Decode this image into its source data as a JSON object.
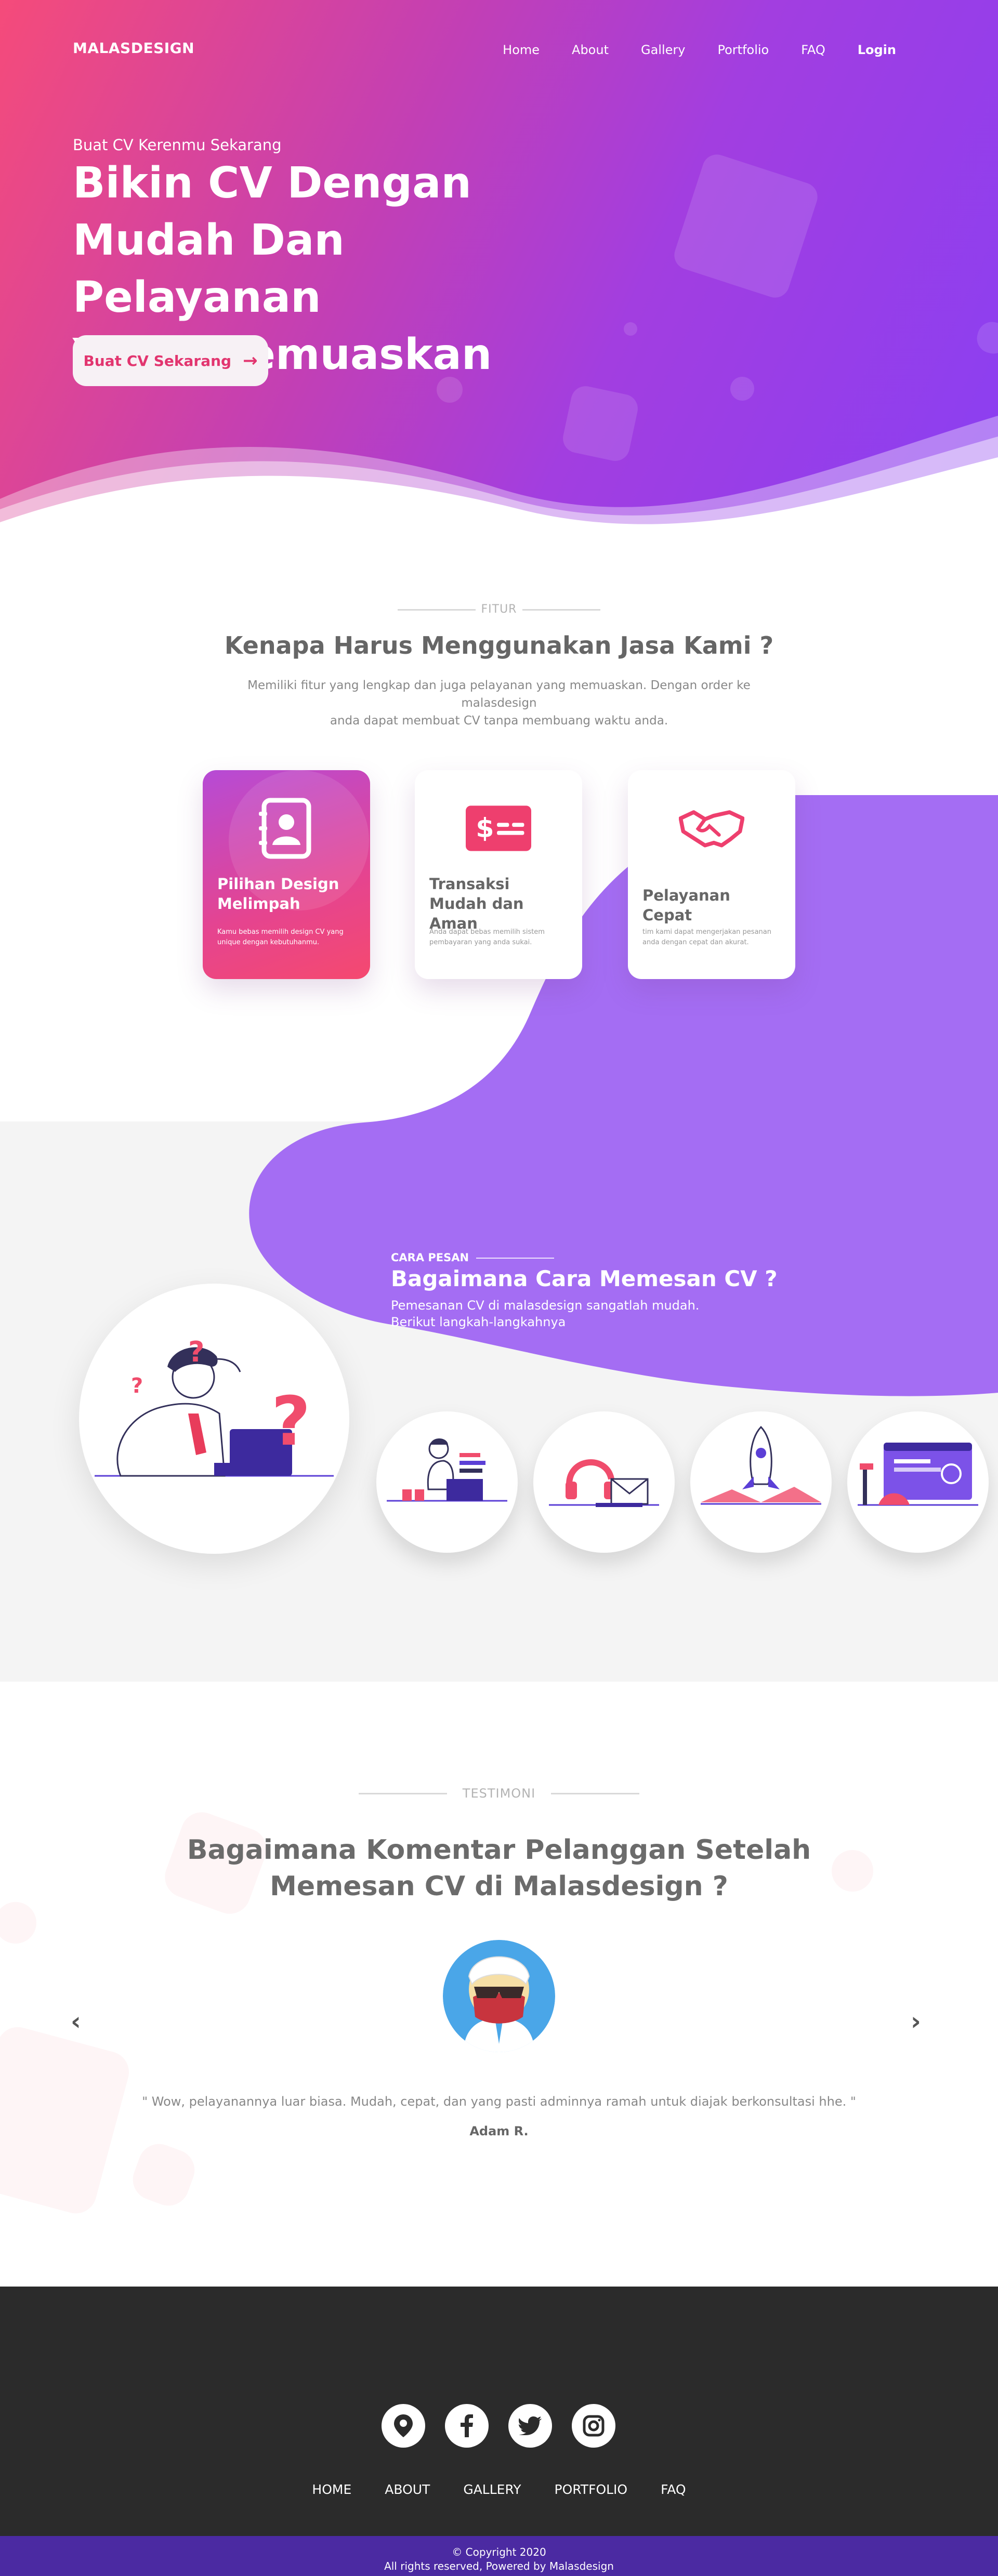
{
  "nav": {
    "logo": "MALASDESIGN",
    "items": [
      {
        "label": "Home"
      },
      {
        "label": "About"
      },
      {
        "label": "Gallery"
      },
      {
        "label": "Portfolio"
      },
      {
        "label": "FAQ"
      }
    ],
    "login": "Login"
  },
  "hero": {
    "subtitle": "Buat CV Kerenmu Sekarang",
    "title_line1": "Bikin CV Dengan",
    "title_line2": "Mudah Dan Pelayanan",
    "title_line3": "Yang Memuaskan",
    "cta": "Buat CV Sekarang",
    "cta_icon": "arrow-right-icon"
  },
  "fitur": {
    "kicker": "FITUR",
    "title": "Kenapa Harus Menggunakan Jasa Kami ?",
    "desc_line1": "Memiliki fitur yang lengkap dan juga pelayanan yang memuaskan. Dengan order ke malasdesign",
    "desc_line2": "anda dapat membuat CV tanpa membuang waktu anda.",
    "cards": [
      {
        "title": "Pilihan Design Melimpah",
        "text": "Kamu bebas memilih design CV yang unique dengan kebutuhanmu.",
        "icon": "contact-book-icon"
      },
      {
        "title": "Transaksi Mudah dan Aman",
        "text": "Anda dapat bebas memilih sistem pembayaran yang anda sukai.",
        "icon": "money-card-icon"
      },
      {
        "title": "Pelayanan Cepat",
        "text": "tim kami dapat mengerjakan pesanan anda dengan cepat dan akurat.",
        "icon": "handshake-icon"
      }
    ]
  },
  "cara": {
    "kicker": "CARA PESAN",
    "title": "Bagaimana Cara Memesan CV ?",
    "desc_line1": "Pemesanan CV di malasdesign sangatlah mudah.",
    "desc_line2": "Berikut langkah-langkahnya"
  },
  "testimoni": {
    "kicker": "TESTIMONI",
    "title_line1": "Bagaimana Komentar Pelanggan Setelah",
    "title_line2": "Memesan CV di Malasdesign ?",
    "quote": "\" Wow, pelayanannya luar biasa. Mudah, cepat, dan yang pasti adminnya ramah untuk diajak berkonsultasi hhe. \"",
    "author": "Adam R.",
    "prev_icon": "chevron-left-icon",
    "next_icon": "chevron-right-icon"
  },
  "footer": {
    "social": [
      "location-pin-icon",
      "facebook-icon",
      "twitter-icon",
      "instagram-icon"
    ],
    "links": [
      {
        "label": "HOME"
      },
      {
        "label": "ABOUT"
      },
      {
        "label": "GALLERY"
      },
      {
        "label": "PORTFOLIO"
      },
      {
        "label": "FAQ"
      }
    ],
    "copyright": "© Copyright 2020",
    "powered": "All rights reserved, Powered by Malasdesign"
  },
  "colors": {
    "hero_start": "#f54b7a",
    "hero_end": "#8a3ff2",
    "accent_pink": "#e2356f",
    "purple_blob": "#a46df3",
    "footer_bg": "#2b2b2b",
    "copyright_bg": "#4b2aa2"
  }
}
